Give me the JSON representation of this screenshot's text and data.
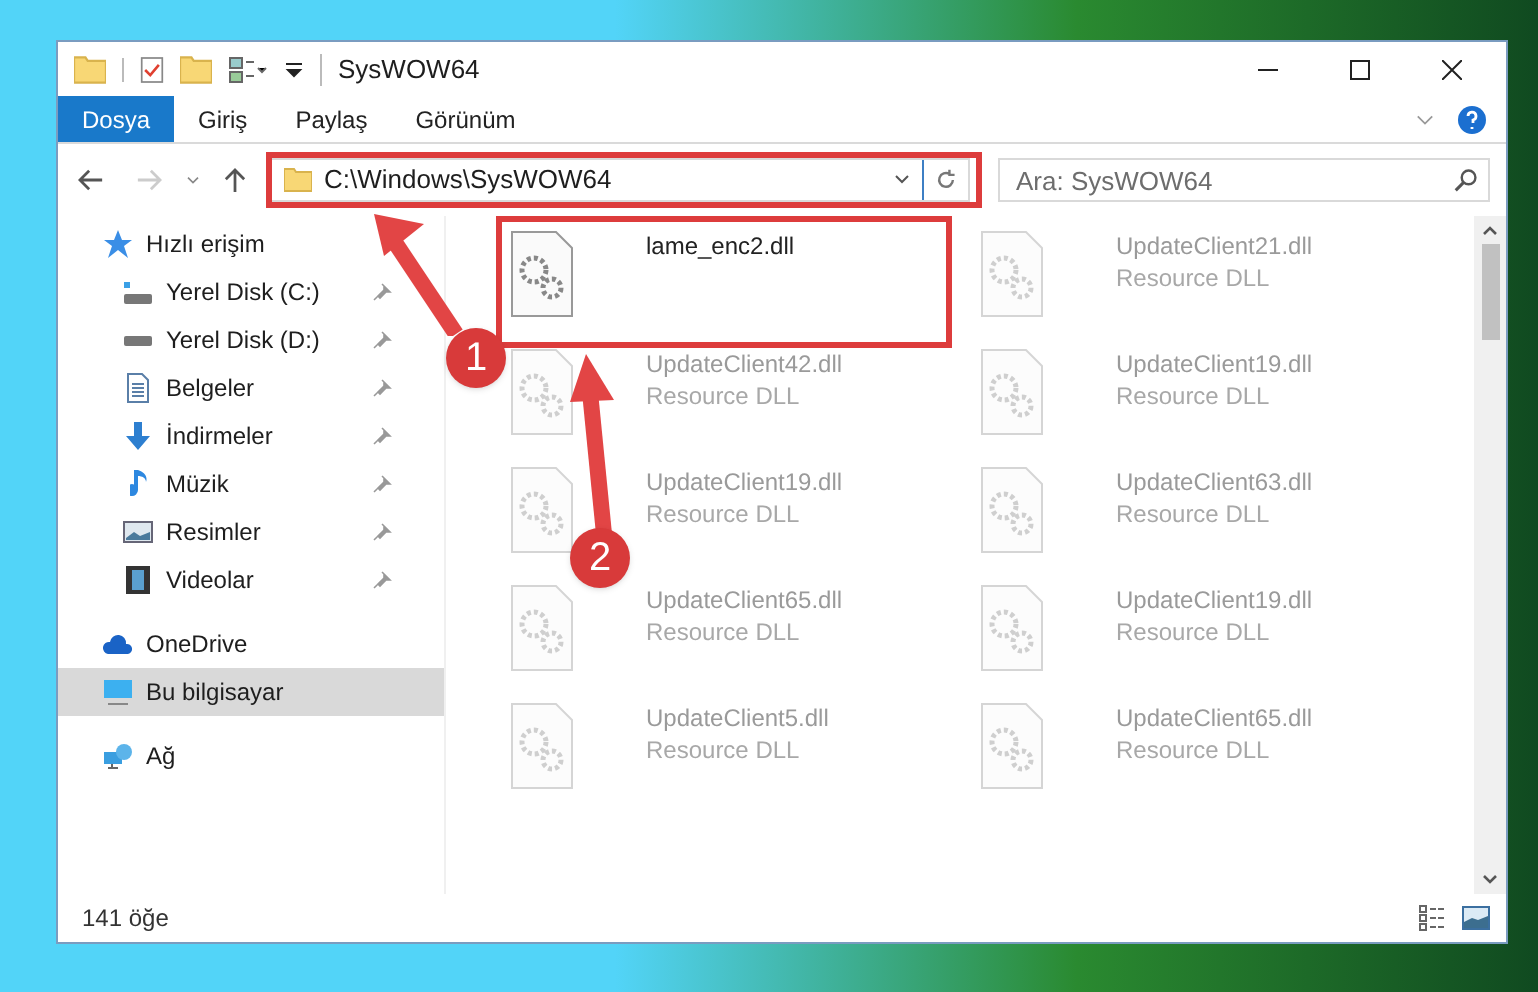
{
  "window": {
    "title": "SysWOW64"
  },
  "ribbon_tabs": [
    {
      "label": "Dosya",
      "selected": true
    },
    {
      "label": "Giriş",
      "selected": false
    },
    {
      "label": "Paylaş",
      "selected": false
    },
    {
      "label": "Görünüm",
      "selected": false
    }
  ],
  "address_bar": {
    "path": "C:\\Windows\\SysWOW64"
  },
  "search": {
    "placeholder": "Ara: SysWOW64"
  },
  "sidebar": {
    "items": [
      {
        "label": "Hızlı erişim",
        "selected": false,
        "children": [
          {
            "label": "Yerel Disk (C:)",
            "selected": false,
            "pinned": true
          },
          {
            "label": "Yerel Disk (D:)",
            "selected": false,
            "pinned": true
          },
          {
            "label": "Belgeler",
            "selected": false,
            "pinned": true
          },
          {
            "label": "İndirmeler",
            "selected": false,
            "pinned": true
          },
          {
            "label": "Müzik",
            "selected": false,
            "pinned": true
          },
          {
            "label": "Resimler",
            "selected": false,
            "pinned": true
          },
          {
            "label": "Videolar",
            "selected": false,
            "pinned": true
          }
        ]
      },
      {
        "label": "OneDrive",
        "selected": false
      },
      {
        "label": "Bu bilgisayar",
        "selected": true
      },
      {
        "label": "Ağ",
        "selected": false
      }
    ]
  },
  "files": [
    {
      "name": "lame_enc2.dll",
      "kind": "clear"
    },
    {
      "name": "UpdateClient21.dll",
      "type": "Resource DLL",
      "kind": "blurred"
    },
    {
      "name": "UpdateClient42.dll",
      "type": "Resource DLL",
      "kind": "blurred"
    },
    {
      "name": "UpdateClient19.dll",
      "type": "Resource DLL",
      "kind": "blurred"
    },
    {
      "name": "UpdateClient19.dll",
      "type": "Resource DLL",
      "kind": "blurred"
    },
    {
      "name": "UpdateClient63.dll",
      "type": "Resource DLL",
      "kind": "blurred"
    },
    {
      "name": "UpdateClient65.dll",
      "type": "Resource DLL",
      "kind": "blurred"
    },
    {
      "name": "UpdateClient19.dll",
      "type": "Resource DLL",
      "kind": "blurred"
    },
    {
      "name": "UpdateClient5.dll",
      "type": "Resource DLL",
      "kind": "blurred"
    },
    {
      "name": "UpdateClient65.dll",
      "type": "Resource DLL",
      "kind": "blurred"
    }
  ],
  "status_bar": {
    "count": "141 öğe"
  },
  "annotations": [
    {
      "label": "1"
    },
    {
      "label": "2"
    }
  ]
}
